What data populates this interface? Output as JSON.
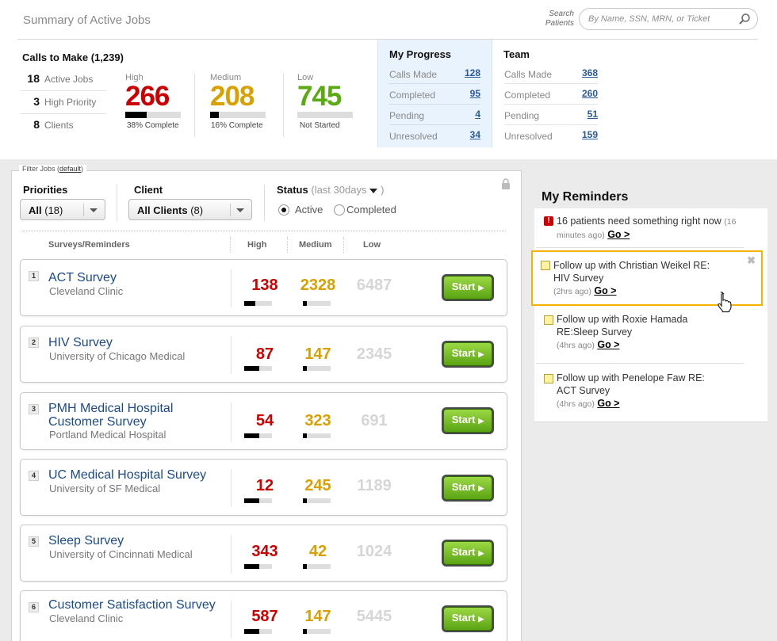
{
  "header": {
    "title": "Summary of Active Jobs",
    "search_label_1": "Search",
    "search_label_2": "Patients",
    "search_placeholder": "By Name, SSN, MRN, or Ticket"
  },
  "calls": {
    "title": "Calls to Make",
    "count": "(1,239)",
    "stats": [
      {
        "n": "18",
        "label": "Active Jobs"
      },
      {
        "n": "3",
        "label": "High Priority"
      },
      {
        "n": "8",
        "label": "Clients"
      }
    ],
    "priorities": [
      {
        "label": "High",
        "value": "266",
        "sub": "38% Complete",
        "fraction": 0.38,
        "color": "#cc0000"
      },
      {
        "label": "Medium",
        "value": "208",
        "sub": "16% Complete",
        "fraction": 0.16,
        "color": "#d9a000"
      },
      {
        "label": "Low",
        "value": "745",
        "sub": "Not Started",
        "fraction": 0.0,
        "color": "#5aaa12"
      }
    ]
  },
  "my_progress": {
    "title": "My Progress",
    "rows": [
      {
        "label": "Calls Made",
        "value": "128"
      },
      {
        "label": "Completed",
        "value": "95"
      },
      {
        "label": "Pending",
        "value": "4"
      },
      {
        "label": "Unresolved",
        "value": "34"
      }
    ]
  },
  "team": {
    "title": "Team",
    "rows": [
      {
        "label": "Calls Made",
        "value": "368"
      },
      {
        "label": "Completed",
        "value": "260"
      },
      {
        "label": "Pending",
        "value": "51"
      },
      {
        "label": "Unresolved",
        "value": "159"
      }
    ]
  },
  "filter": {
    "tag": "Filter Jobs",
    "default_link": "default",
    "priorities_label": "Priorities",
    "priorities_value": "All",
    "priorities_count": "(18)",
    "client_label": "Client",
    "client_value": "All Clients",
    "client_count": "(8)",
    "status_label": "Status",
    "status_range_prefix": "(last 30days",
    "status_range_suffix": ")",
    "radio_active": "Active",
    "radio_completed": "Completed",
    "selected_status": "Active"
  },
  "columns": {
    "surveys": "Surveys/Reminders",
    "high": "High",
    "medium": "Medium",
    "low": "Low"
  },
  "jobs": [
    {
      "num": "1",
      "name": "ACT Survey",
      "client": "Cleveland Clinic",
      "high": "138",
      "medium": "2328",
      "low": "6487",
      "high_fraction": 0.4,
      "medium_fraction": 0.15,
      "start": "Start"
    },
    {
      "num": "2",
      "name": "HIV Survey",
      "client": "University of Chicago Medical",
      "high": "87",
      "medium": "147",
      "low": "2345",
      "high_fraction": 0.55,
      "medium_fraction": 0.15,
      "start": "Start"
    },
    {
      "num": "3",
      "name": "PMH Medical Hospital Customer Survey",
      "client": "Portland Medical Hospital",
      "high": "54",
      "medium": "323",
      "low": "691",
      "high_fraction": 0.55,
      "medium_fraction": 0.15,
      "start": "Start"
    },
    {
      "num": "4",
      "name": "UC Medical Hospital Survey",
      "client": "University of SF Medical",
      "high": "12",
      "medium": "245",
      "low": "1189",
      "high_fraction": 0.55,
      "medium_fraction": 0.15,
      "start": "Start"
    },
    {
      "num": "5",
      "name": "Sleep Survey",
      "client": "University of Cincinnati Medical",
      "high": "343",
      "medium": "42",
      "low": "1024",
      "high_fraction": 0.55,
      "medium_fraction": 0.15,
      "start": "Start"
    },
    {
      "num": "6",
      "name": "Customer Satisfaction Survey",
      "client": "Cleveland Clinic",
      "high": "587",
      "medium": "147",
      "low": "5445",
      "high_fraction": 0.55,
      "medium_fraction": 0.15,
      "start": "Start"
    }
  ],
  "reminders": {
    "title": "My Reminders",
    "items": [
      {
        "text": "16 patients need something right now",
        "ago": "(16 minutes ago)",
        "go": "Go >"
      },
      {
        "text": "Follow up with Christian Weikel RE: HIV Survey",
        "ago": "(2hrs ago)",
        "go": "Go >"
      },
      {
        "text": "Follow up with Roxie Hamada RE:Sleep Survey",
        "ago": "(4hrs ago)",
        "go": "Go >"
      },
      {
        "text": "Follow up with Penelope Faw RE: ACT Survey",
        "ago": "(4hrs ago)",
        "go": "Go >"
      }
    ]
  }
}
